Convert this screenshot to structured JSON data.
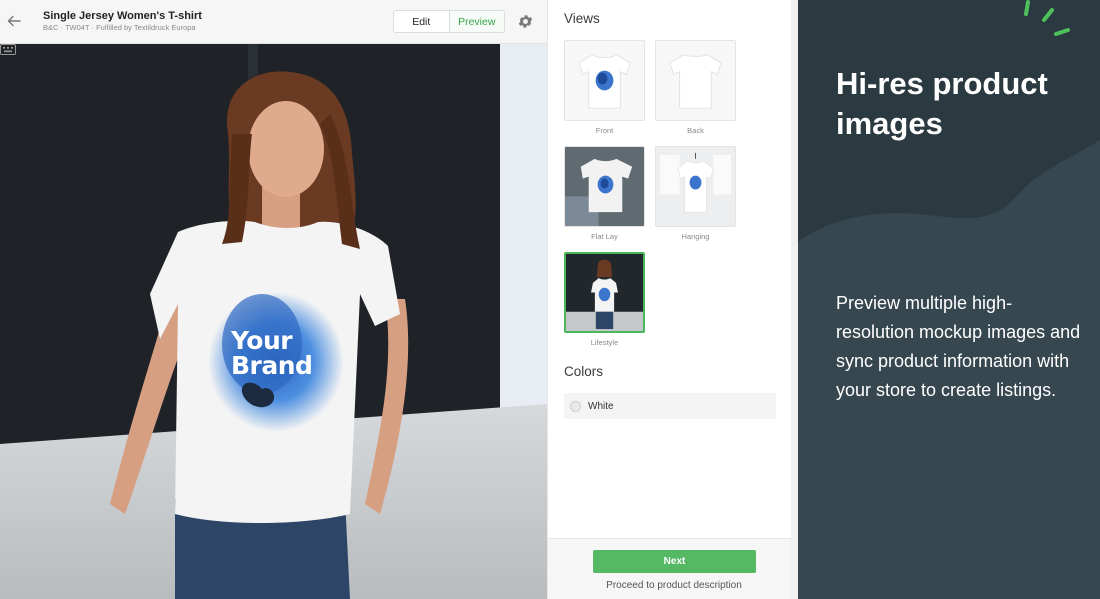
{
  "header": {
    "title": "Single Jersey Women's T-shirt",
    "subtitle": "B&C · TW04T · Fulfilled by Textildruck Europa",
    "edit_label": "Edit",
    "preview_label": "Preview"
  },
  "mockup": {
    "brand_line1": "Your",
    "brand_line2": "Brand"
  },
  "views": {
    "title": "Views",
    "items": [
      {
        "label": "Front",
        "selected": false
      },
      {
        "label": "Back",
        "selected": false
      },
      {
        "label": "Flat Lay",
        "selected": false
      },
      {
        "label": "Hanging",
        "selected": false
      },
      {
        "label": "Lifestyle",
        "selected": true
      }
    ]
  },
  "colors": {
    "title": "Colors",
    "items": [
      {
        "name": "White",
        "hex": "#ffffff"
      }
    ]
  },
  "footer": {
    "next_label": "Next",
    "hint": "Proceed to product description"
  },
  "promo": {
    "heading": "Hi-res product images",
    "body": "Preview multiple high-resolution mockup images and sync product information with your store to create listings."
  },
  "theme": {
    "accent": "#55b863",
    "promo_bg": "#37474f",
    "promo_bg_dark": "#2b3940"
  }
}
